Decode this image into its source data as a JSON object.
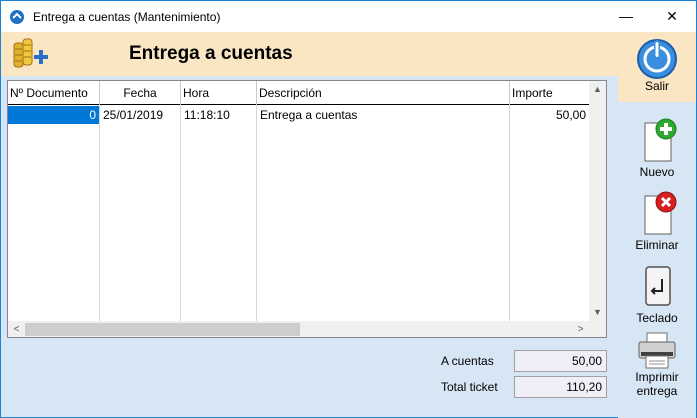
{
  "window": {
    "title": "Entrega a cuentas (Mantenimiento)",
    "minimize_glyph": "—",
    "close_glyph": "✕"
  },
  "header": {
    "heading": "Entrega a cuentas",
    "logo_icon": "coins-plus-icon"
  },
  "toolbar": {
    "salir": "Salir",
    "nuevo": "Nuevo",
    "eliminar": "Eliminar",
    "teclado": "Teclado",
    "imprimir_1": "Imprimir",
    "imprimir_2": "entrega"
  },
  "table": {
    "columns": [
      "Nº Documento",
      "Fecha",
      "Hora",
      "Descripción",
      "Importe"
    ],
    "rows": [
      [
        "0",
        "25/01/2019",
        "11:18:10",
        "Entrega a cuentas",
        "50,00"
      ]
    ]
  },
  "scroll": {
    "up": "▲",
    "down": "▼",
    "left": "<",
    "right": ">"
  },
  "totals": {
    "a_cuentas_label": "A cuentas",
    "a_cuentas_value": "50,00",
    "total_ticket_label": "Total ticket",
    "total_ticket_value": "110,20"
  },
  "colors": {
    "header_bg": "#fbe6c4",
    "body_bg": "#d7e6f4",
    "selection": "#0078d7"
  }
}
